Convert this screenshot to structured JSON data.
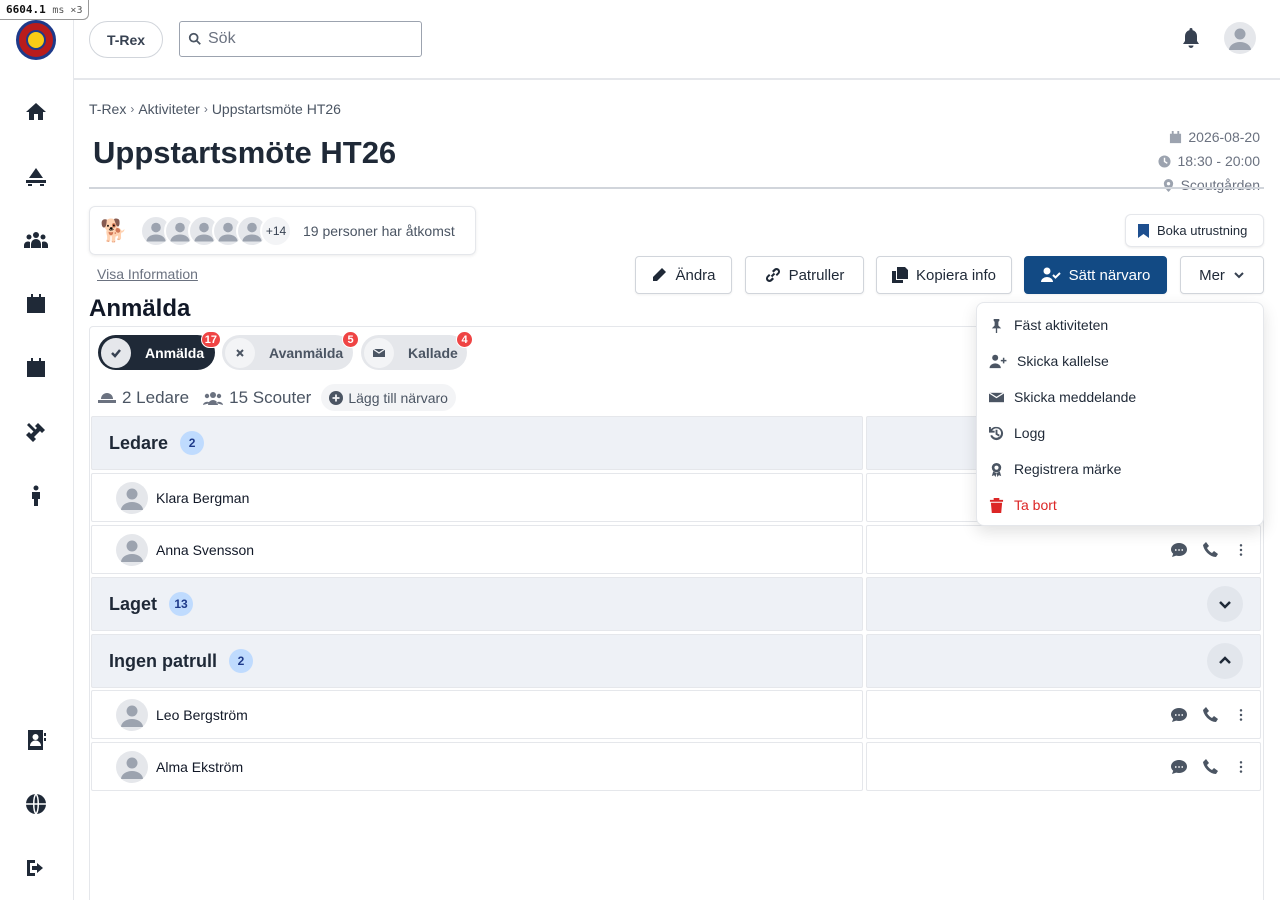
{
  "perf": {
    "value": "6604.1",
    "unit": "ms ×3"
  },
  "topbar": {
    "app_button": "T-Rex",
    "search_placeholder": "Sök"
  },
  "breadcrumb": [
    "T-Rex",
    "Aktiviteter",
    "Uppstartsmöte HT26"
  ],
  "activity": {
    "title": "Uppstartsmöte HT26",
    "date": "2026-08-20",
    "time": "18:30 - 20:00",
    "location": "Scoutgården"
  },
  "access": {
    "more_count": "+14",
    "text": "19 personer har åtkomst"
  },
  "buttons": {
    "boka": "Boka utrustning",
    "visa_info": "Visa Information",
    "andra": "Ändra",
    "patruller": "Patruller",
    "kopiera": "Kopiera info",
    "satt_narvaro": "Sätt närvaro",
    "mer": "Mer"
  },
  "section_title": "Anmälda",
  "tabs": [
    {
      "label": "Anmälda",
      "count": "17"
    },
    {
      "label": "Avanmälda",
      "count": "5"
    },
    {
      "label": "Kallade",
      "count": "4"
    }
  ],
  "counts": {
    "leaders": "2 Ledare",
    "scouts": "15 Scouter",
    "add": "Lägg till närvaro"
  },
  "groups": [
    {
      "name": "Ledare",
      "count": "2"
    },
    {
      "name": "Laget",
      "count": "13"
    },
    {
      "name": "Ingen patrull",
      "count": "2"
    }
  ],
  "people": [
    "Klara Bergman",
    "Anna Svensson",
    "Leo Bergström",
    "Alma Ekström"
  ],
  "menu": [
    "Fäst aktiviteten",
    "Skicka kallelse",
    "Skicka meddelande",
    "Logg",
    "Registrera märke",
    "Ta bort"
  ],
  "colors": {
    "primary": "#124a84",
    "danger": "#ef4444",
    "group_bg": "#eef1f6"
  }
}
